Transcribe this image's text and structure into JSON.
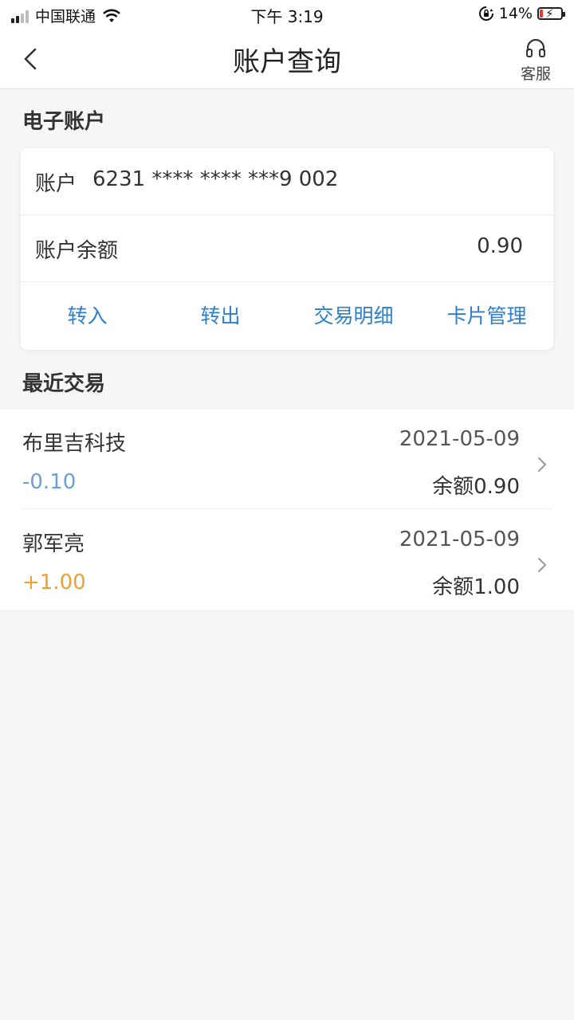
{
  "status_bar": {
    "carrier": "中国联通",
    "time": "下午 3:19",
    "battery_percent": "14%",
    "battery_level": 0.14,
    "battery_color": "#e53935"
  },
  "nav": {
    "title": "账户查询",
    "back_icon": "chevron-left-icon",
    "service_label": "客服",
    "service_icon": "headset-icon"
  },
  "account": {
    "section_title": "电子账户",
    "account_label": "账户",
    "account_number": "6231 **** **** ***9 002",
    "balance_label": "账户余额",
    "balance_value": "0.90",
    "actions": [
      "转入",
      "转出",
      "交易明细",
      "卡片管理"
    ],
    "action_color": "#2f7fd0"
  },
  "recent": {
    "section_title": "最近交易",
    "transactions": [
      {
        "name": "布里吉科技",
        "date": "2021-05-09",
        "amount": "-0.10",
        "amount_color": "#6a9fd8",
        "balance": "余额0.90"
      },
      {
        "name": "郭军亮",
        "date": "2021-05-09",
        "amount": "+1.00",
        "amount_color": "#f0a030",
        "balance": "余额1.00"
      }
    ]
  }
}
